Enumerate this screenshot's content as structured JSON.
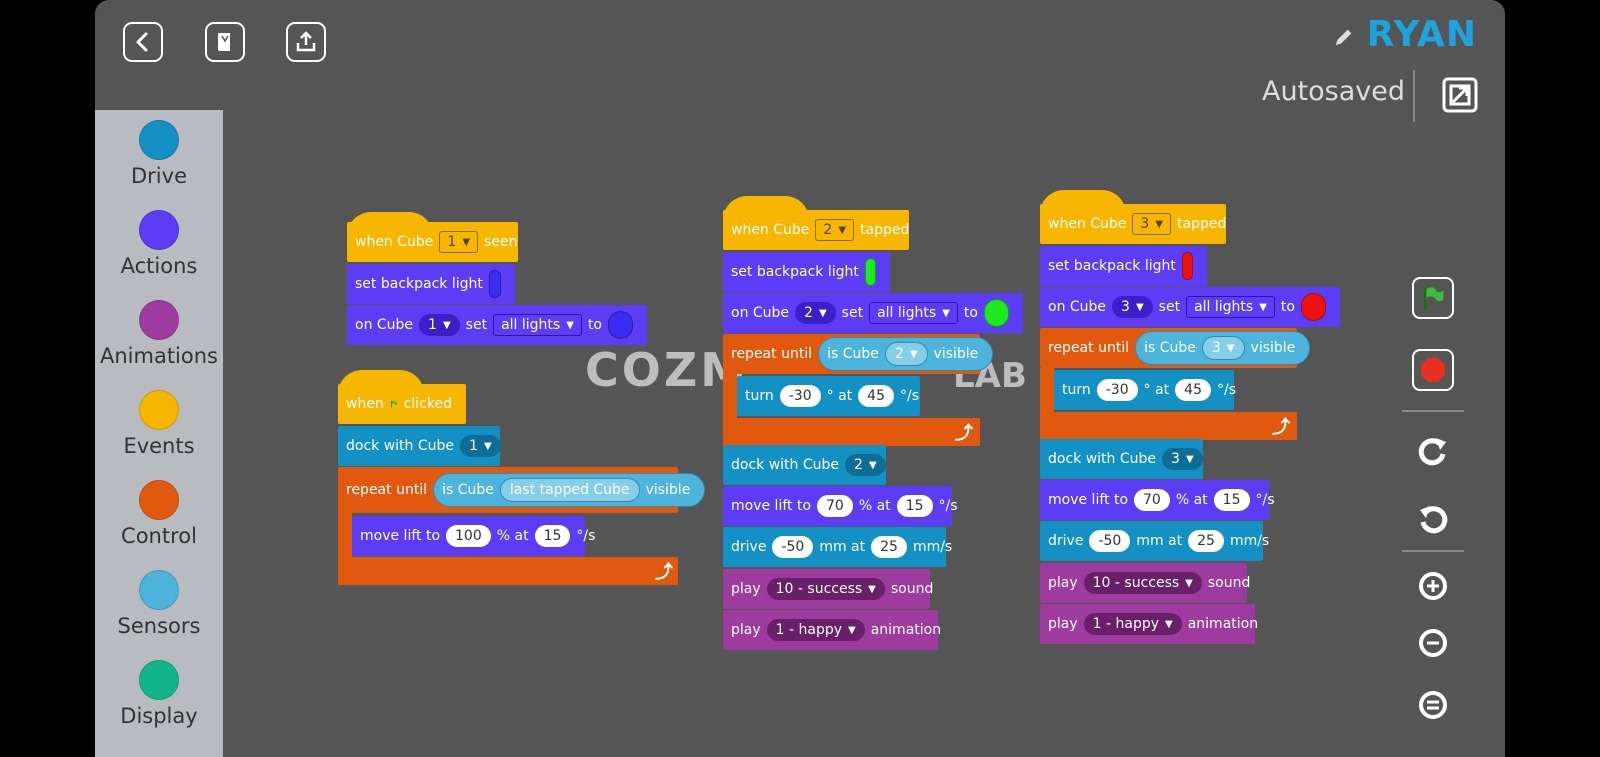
{
  "project": {
    "name": "RYAN",
    "status": "Autosaved"
  },
  "palette": [
    {
      "label": "Drive",
      "color": "#1391c4"
    },
    {
      "label": "Actions",
      "color": "#5c3cf5"
    },
    {
      "label": "Animations",
      "color": "#9e3b9e"
    },
    {
      "label": "Events",
      "color": "#f6b602"
    },
    {
      "label": "Control",
      "color": "#e0590e"
    },
    {
      "label": "Sensors",
      "color": "#4db4dc"
    },
    {
      "label": "Display",
      "color": "#12b58a"
    }
  ],
  "watermark": {
    "left": "COZM",
    "right": "LAB"
  },
  "script1": {
    "hat": {
      "prefix": "when Cube",
      "cube": "1",
      "suffix": "seen"
    },
    "light": {
      "label": "set backpack light",
      "color": "#3a2cf0"
    },
    "oncube": {
      "prefix": "on Cube",
      "cube": "1",
      "set": "set",
      "lights": "all lights",
      "to": "to",
      "color": "#3a2cf0"
    }
  },
  "script2": {
    "hat": {
      "prefix": "when",
      "suffix": "clicked"
    },
    "dock": {
      "label": "dock with Cube",
      "cube": "1"
    },
    "repeat": {
      "prefix": "repeat until",
      "is": "is Cube",
      "cube": "last tapped Cube",
      "suffix": "visible"
    },
    "lift": {
      "label": "move lift to",
      "value": "100",
      "pct": "% at",
      "speed": "15",
      "unit": "°/s"
    }
  },
  "script3": {
    "hat": {
      "prefix": "when Cube",
      "cube": "2",
      "suffix": "tapped"
    },
    "light": {
      "label": "set backpack light",
      "color": "#1ee81e"
    },
    "oncube": {
      "prefix": "on Cube",
      "cube": "2",
      "set": "set",
      "lights": "all lights",
      "to": "to",
      "color": "#1ee81e"
    },
    "repeat": {
      "prefix": "repeat until",
      "is": "is Cube",
      "cube": "2",
      "suffix": "visible"
    },
    "turn": {
      "label": "turn",
      "deg": "-30",
      "at": "° at",
      "speed": "45",
      "unit": "°/s"
    },
    "dock": {
      "label": "dock with Cube",
      "cube": "2"
    },
    "lift": {
      "label": "move lift to",
      "value": "70",
      "pct": "% at",
      "speed": "15",
      "unit": "°/s"
    },
    "drive": {
      "label": "drive",
      "dist": "-50",
      "mm": "mm at",
      "speed": "25",
      "unit": "mm/s"
    },
    "sound": {
      "label": "play",
      "value": "10 - success",
      "suffix": "sound"
    },
    "anim": {
      "label": "play",
      "value": "1 - happy",
      "suffix": "animation"
    }
  },
  "script4": {
    "hat": {
      "prefix": "when Cube",
      "cube": "3",
      "suffix": "tapped"
    },
    "light": {
      "label": "set backpack light",
      "color": "#ee1111"
    },
    "oncube": {
      "prefix": "on Cube",
      "cube": "3",
      "set": "set",
      "lights": "all lights",
      "to": "to",
      "color": "#ee1111"
    },
    "repeat": {
      "prefix": "repeat until",
      "is": "is Cube",
      "cube": "3",
      "suffix": "visible"
    },
    "turn": {
      "label": "turn",
      "deg": "-30",
      "at": "° at",
      "speed": "45",
      "unit": "°/s"
    },
    "dock": {
      "label": "dock with Cube",
      "cube": "3"
    },
    "lift": {
      "label": "move lift to",
      "value": "70",
      "pct": "% at",
      "speed": "15",
      "unit": "°/s"
    },
    "drive": {
      "label": "drive",
      "dist": "-50",
      "mm": "mm at",
      "speed": "25",
      "unit": "mm/s"
    },
    "sound": {
      "label": "play",
      "value": "10 - success",
      "suffix": "sound"
    },
    "anim": {
      "label": "play",
      "value": "1 - happy",
      "suffix": "animation"
    }
  },
  "tools": [
    "green-flag-icon",
    "stop-icon",
    "redo-icon",
    "undo-icon",
    "zoom-in-icon",
    "zoom-out-icon",
    "zoom-reset-icon"
  ]
}
